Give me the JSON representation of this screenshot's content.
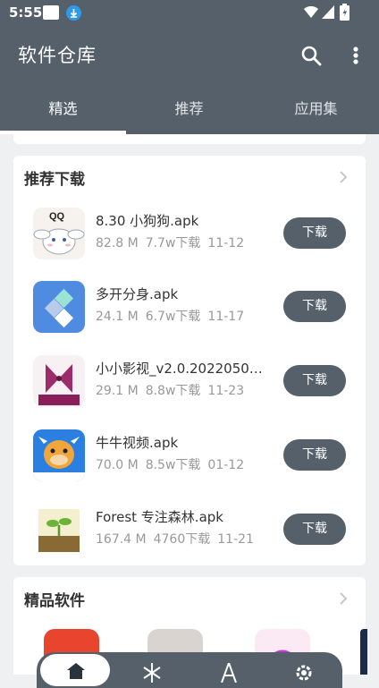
{
  "status_bar": {
    "time": "5:55"
  },
  "app_bar": {
    "title": "软件仓库"
  },
  "tabs": [
    {
      "label": "精选",
      "active": true
    },
    {
      "label": "推荐",
      "active": false
    },
    {
      "label": "应用集",
      "active": false
    }
  ],
  "recommended": {
    "title": "推荐下载",
    "apps": [
      {
        "name": "8.30 小狗狗.apk",
        "size": "82.8 M",
        "downloads": "7.7w下载",
        "date": "11-12",
        "button": "下载",
        "icon": "cinnamoroll-qq-icon"
      },
      {
        "name": "多开分身.apk",
        "size": "24.1 M",
        "downloads": "6.7w下载",
        "date": "11-17",
        "button": "下载",
        "icon": "dual-space-icon"
      },
      {
        "name": "小小影视_v2.0.2022050…",
        "size": "29.1 M",
        "downloads": "8.8w下载",
        "date": "11-23",
        "button": "下载",
        "icon": "xiaoxiao-video-icon"
      },
      {
        "name": "牛牛视频.apk",
        "size": "70.0 M",
        "downloads": "8.5w下载",
        "date": "01-12",
        "button": "下载",
        "icon": "niuniu-video-icon"
      },
      {
        "name": "Forest 专注森林.apk",
        "size": "167.4 M",
        "downloads": "4760下载",
        "date": "11-21",
        "button": "下载",
        "icon": "forest-sprout-icon"
      }
    ]
  },
  "featured": {
    "title": "精品软件"
  },
  "colors": {
    "primary": "#56606b",
    "background": "#eef0f2"
  }
}
